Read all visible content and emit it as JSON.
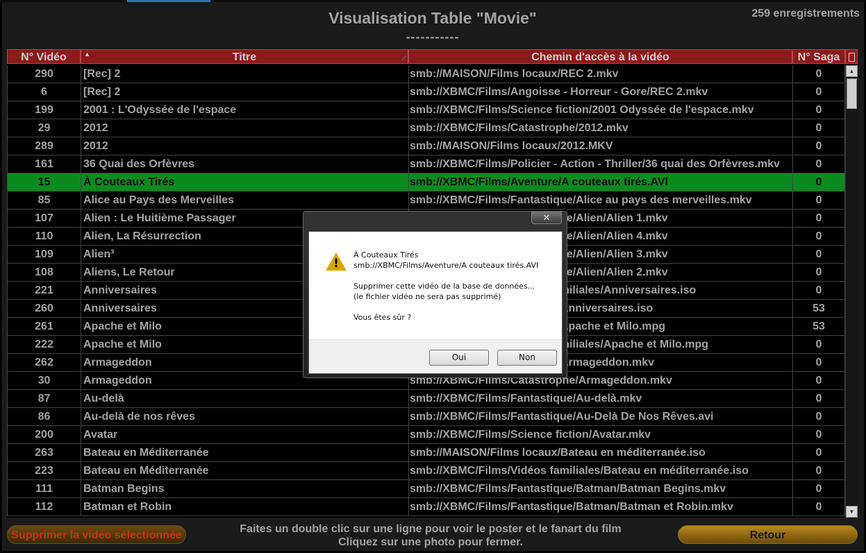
{
  "header": {
    "title": "Visualisation Table \"Movie\"",
    "underline": "-----------",
    "record_count": "259 enregistrements"
  },
  "columns": [
    "N° Vidéo",
    "Titre",
    "Chemin d'accès à la vidéo",
    "N° Saga"
  ],
  "rows": [
    {
      "num": "290",
      "title": "[Rec] 2",
      "path": "smb://MAISON/Films locaux/REC 2.mkv",
      "saga": "0"
    },
    {
      "num": "6",
      "title": "[Rec] 2",
      "path": "smb://XBMC/Films/Angoisse - Horreur - Gore/REC 2.mkv",
      "saga": "0"
    },
    {
      "num": "199",
      "title": "2001 : L'Odyssée de l'espace",
      "path": "smb://XBMC/Films/Science fiction/2001 Odyssée de l'espace.mkv",
      "saga": "0"
    },
    {
      "num": "29",
      "title": "2012",
      "path": "smb://XBMC/Films/Catastrophe/2012.mkv",
      "saga": "0"
    },
    {
      "num": "289",
      "title": "2012",
      "path": "smb://MAISON/Films locaux/2012.MKV",
      "saga": "0"
    },
    {
      "num": "161",
      "title": "36 Quai des Orfèvres",
      "path": "smb://XBMC/Films/Policier - Action - Thriller/36 quai des Orfèvres.mkv",
      "saga": "0"
    },
    {
      "num": "15",
      "title": "À Couteaux Tirés",
      "path": "smb://XBMC/Films/Aventure/A couteaux tirés.AVI",
      "saga": "0",
      "selected": true
    },
    {
      "num": "85",
      "title": "Alice au Pays des Merveilles",
      "path": "smb://XBMC/Films/Fantastique/Alice au pays des merveilles.mkv",
      "saga": "0"
    },
    {
      "num": "107",
      "title": "Alien : Le Huitième Passager",
      "path": "smb://XBMC/Films/Fantastique/Alien/Alien 1.mkv",
      "saga": "0"
    },
    {
      "num": "110",
      "title": "Alien, La Résurrection",
      "path": "smb://XBMC/Films/Fantastique/Alien/Alien 4.mkv",
      "saga": "0"
    },
    {
      "num": "109",
      "title": "Alien³",
      "path": "smb://XBMC/Films/Fantastique/Alien/Alien 3.mkv",
      "saga": "0"
    },
    {
      "num": "108",
      "title": "Aliens, Le Retour",
      "path": "smb://XBMC/Films/Fantastique/Alien/Alien 2.mkv",
      "saga": "0"
    },
    {
      "num": "221",
      "title": "Anniversaires",
      "path": "smb://XBMC/Films/Vidéos familiales/Anniversaires.iso",
      "saga": "0"
    },
    {
      "num": "260",
      "title": "Anniversaires",
      "path": "smb://MAISON/Films locaux/Anniversaires.iso",
      "saga": "53"
    },
    {
      "num": "261",
      "title": "Apache et Milo",
      "path": "smb://MAISON/Films locaux/Apache et Milo.mpg",
      "saga": "53"
    },
    {
      "num": "222",
      "title": "Apache et Milo",
      "path": "smb://XBMC/Films/Vidéos familiales/Apache et Milo.mpg",
      "saga": "0"
    },
    {
      "num": "262",
      "title": "Armageddon",
      "path": "smb://MAISON/Films locaux/Armageddon.mkv",
      "saga": "0"
    },
    {
      "num": "30",
      "title": "Armageddon",
      "path": "smb://XBMC/Films/Catastrophe/Armageddon.mkv",
      "saga": "0"
    },
    {
      "num": "87",
      "title": "Au-delà",
      "path": "smb://XBMC/Films/Fantastique/Au-delà.mkv",
      "saga": "0"
    },
    {
      "num": "86",
      "title": "Au-delà de nos rêves",
      "path": "smb://XBMC/Films/Fantastique/Au-Delà De Nos Rêves.avi",
      "saga": "0"
    },
    {
      "num": "200",
      "title": "Avatar",
      "path": "smb://XBMC/Films/Science fiction/Avatar.mkv",
      "saga": "0"
    },
    {
      "num": "263",
      "title": "Bateau en Méditerranée",
      "path": "smb://MAISON/Films locaux/Bateau en méditerranée.iso",
      "saga": "0"
    },
    {
      "num": "223",
      "title": "Bateau en Méditerranée",
      "path": "smb://XBMC/Films/Vidéos familiales/Bateau en méditerranée.iso",
      "saga": "0"
    },
    {
      "num": "111",
      "title": "Batman Begins",
      "path": "smb://XBMC/Films/Fantastique/Batman/Batman Begins.mkv",
      "saga": "0"
    },
    {
      "num": "112",
      "title": "Batman et Robin",
      "path": "smb://XBMC/Films/Fantastique/Batman/Batman et Robin.mkv",
      "saga": "0"
    }
  ],
  "footer": {
    "delete_label": "Supprimer la vidéo sélectionnée",
    "hint_line1": "Faites un double clic sur une ligne pour voir le poster et le fanart du film",
    "hint_line2": "Cliquez sur une photo pour fermer.",
    "back_label": "Retour"
  },
  "dialog": {
    "close_glyph": "✕",
    "line1": "À Couteaux Tirés",
    "line2": "smb://XBMC/Films/Aventure/A couteaux tirés.AVI",
    "line3": "Supprimer cette vidéo de la base de données...",
    "line4": "(le fichier vidéo ne sera pas supprimé)",
    "line5": "Vous êtes sûr ?",
    "yes_label": "Oui",
    "no_label": "Non",
    "icon": "warning-icon"
  },
  "colors": {
    "header_red": "#8b1a1a",
    "selected_green": "#0b8a1e",
    "delete_text": "#c83214",
    "back_gold": "#b88820"
  }
}
